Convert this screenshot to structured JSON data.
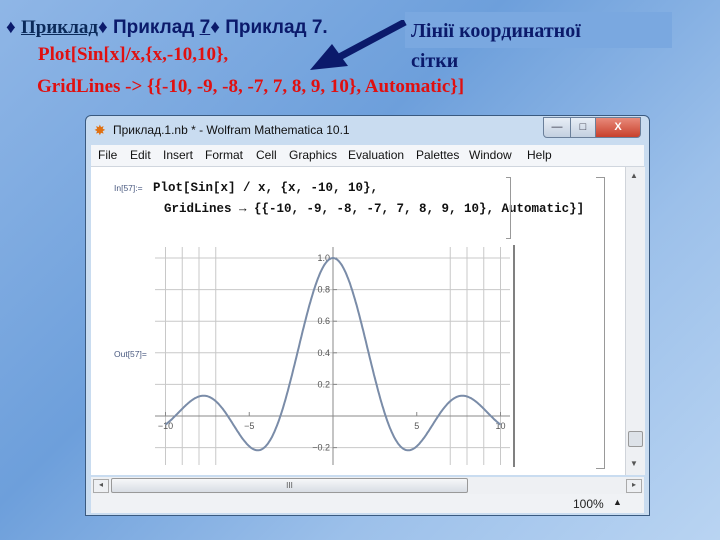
{
  "slide": {
    "heading": {
      "link": "Приклад",
      "part2": "♦ Приклад ",
      "part2_link": "7",
      "part3": "♦ Приклад 7.",
      "bullet": "♦ "
    },
    "code_line1": "Plot[Sin[x]/x,{x,-10,10},",
    "code_line2": "GridLines -> {{-10, -9, -8, -7, 7, 8, 9, 10}, Automatic}]",
    "callout_line1": "Лінії координатної",
    "callout_line2": "сітки",
    "arrow_icon": "arrow-pointing-left",
    "colors": {
      "code": "#e01010",
      "heading": "#0b1a6b",
      "arrow": "#0b1a6b"
    }
  },
  "window": {
    "title": "Приклад.1.nb * - Wolfram Mathematica 10.1",
    "buttons": {
      "minimize": "—",
      "maximize": "□",
      "close": "X"
    },
    "menu": [
      "File",
      "Edit",
      "Insert",
      "Format",
      "Cell",
      "Graphics",
      "Evaluation",
      "Palettes",
      "Window",
      "Help"
    ],
    "input_label": "In[57]:=",
    "input_line1": "Plot[Sin[x] / x, {x, -10, 10},",
    "input_line2": "GridLines → {{-10, -9, -8, -7, 7, 8, 9, 10}, Automatic}]",
    "output_label": "Out[57]=",
    "zoom": "100%",
    "scroll_grip": "III"
  },
  "chart_data": {
    "type": "line",
    "function": "Sin[x]/x",
    "xlim": [
      -10,
      10
    ],
    "ylim": [
      -0.25,
      1.05
    ],
    "x_ticks": [
      "-10",
      "-5",
      "5",
      "10"
    ],
    "x_tick_values": [
      -10,
      -5,
      5,
      10
    ],
    "y_ticks": [
      "1.0",
      "0.8",
      "0.6",
      "0.4",
      "0.2",
      "-0.2"
    ],
    "y_tick_values": [
      1.0,
      0.8,
      0.6,
      0.4,
      0.2,
      -0.2
    ],
    "x_gridlines": [
      -10,
      -9,
      -8,
      -7,
      7,
      8,
      9,
      10
    ],
    "y_gridlines": [
      -0.2,
      0.2,
      0.4,
      0.6,
      0.8,
      1.0
    ],
    "line_color": "#7a8ca8"
  }
}
